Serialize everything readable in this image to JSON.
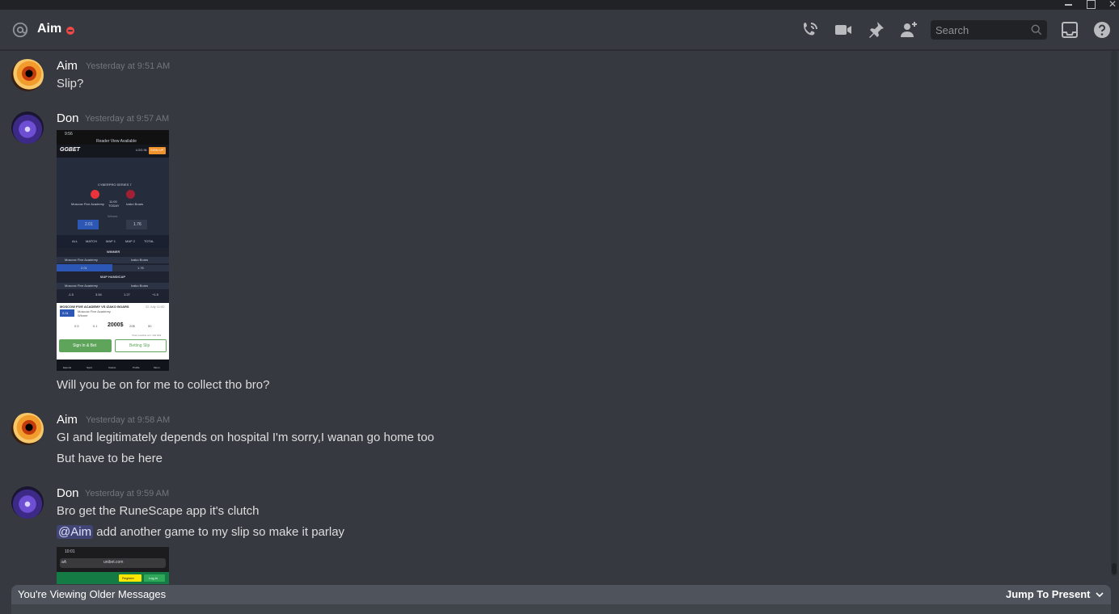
{
  "header": {
    "channel_name": "Aim",
    "status": "do-not-disturb",
    "status_color": "#f04747",
    "search_placeholder": "Search",
    "icons": [
      "at-icon",
      "call-icon",
      "video-icon",
      "pin-icon",
      "add-member-icon",
      "search-icon",
      "inbox-icon",
      "help-icon"
    ]
  },
  "messages": [
    {
      "author": "Aim",
      "timestamp": "Yesterday at 9:51 AM",
      "lines": [
        "Slip?"
      ]
    },
    {
      "author": "Don",
      "timestamp": "Yesterday at 9:57 AM",
      "lines": [
        "Will you be on for me to collect tho bro?"
      ],
      "attachment": {
        "time": "9:56",
        "reader": "Reader View Available",
        "logo": "GGBET",
        "login": "LOG IN",
        "signup": "SIGN UP",
        "event": "CYBERPRO SERIES 7",
        "team1": "Moscow Five Academy",
        "team2": "Izako Boars",
        "match_time": "11:00",
        "match_day": "TODAY",
        "winner_label": "Winner",
        "odds1": "2.01",
        "odds2": "1.76",
        "tabs": [
          "ALL",
          "MATCH",
          "MAP 1",
          "MAP 2",
          "TOTAL"
        ],
        "market1": "WINNER",
        "market2": "MAP HANDICAP",
        "hc_values": [
          "-1.5",
          "3.54",
          "1.27",
          "+1.5"
        ],
        "slip_title": "MOSCOW FIVE ACADEMY VS IZAKO BOARS",
        "slip_date": "22 July 11:00",
        "slip_odds": "2.01",
        "slip_pick": "Moscow Five Academy",
        "slip_market": "Winner",
        "stake": "2000$",
        "stakes": [
          "0.5",
          "0.1",
          "20$",
          "50"
        ],
        "possible": "Total possible win: 402.00$",
        "btn_signin": "Sign In & Bet",
        "btn_slip": "Betting Slip",
        "nav": [
          "Esports",
          "Sport",
          "Casino",
          "Profile",
          "Menu"
        ]
      }
    },
    {
      "author": "Aim",
      "timestamp": "Yesterday at 9:58 AM",
      "lines": [
        "GI and legitimately depends on hospital I'm sorry,I wanan go home too",
        "But have to be here"
      ]
    },
    {
      "author": "Don",
      "timestamp": "Yesterday at 9:59 AM",
      "lines": [
        "Bro get the RuneScape app it's clutch"
      ],
      "mention": "@Aim",
      "mention_line": "add another game to my slip so make it parlay",
      "attachment": {
        "time": "10:01",
        "aa": "aA",
        "url": "unibet.com",
        "register": "Register",
        "login": "Log in"
      }
    }
  ],
  "bottom_bar": {
    "older_text": "You're Viewing Older Messages",
    "jump_label": "Jump To Present"
  }
}
